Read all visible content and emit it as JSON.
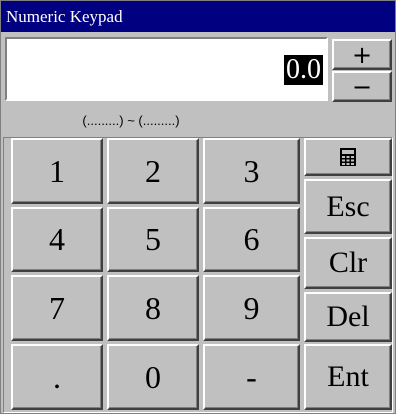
{
  "window": {
    "title": "Numeric Keypad"
  },
  "display": {
    "value": "0.0"
  },
  "range": {
    "text": "(.........) ~ (.........)"
  },
  "keys": {
    "k1": "1",
    "k2": "2",
    "k3": "3",
    "k4": "4",
    "k5": "5",
    "k6": "6",
    "k7": "7",
    "k8": "8",
    "k9": "9",
    "dot": ".",
    "k0": "0",
    "minus": "-"
  },
  "side": {
    "plus": "+",
    "minus": "−",
    "calc_icon": "calculator-icon",
    "esc": "Esc",
    "clr": "Clr",
    "del": "Del",
    "ent": "Ent"
  },
  "colors": {
    "title_bar": "#000080",
    "face": "#c0c0c0",
    "value_bg": "#000000"
  }
}
